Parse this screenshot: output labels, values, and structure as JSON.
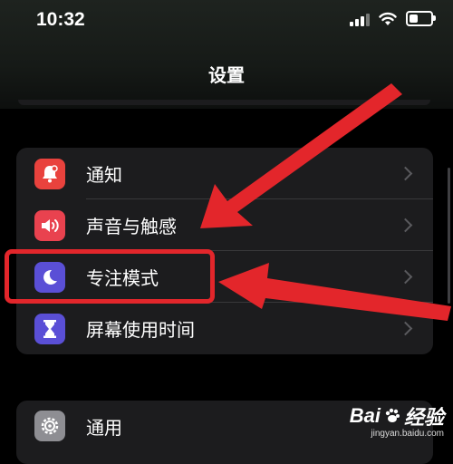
{
  "status": {
    "time": "10:32"
  },
  "nav": {
    "title": "设置"
  },
  "group1": [
    {
      "label": "通知",
      "icon": "bell-icon",
      "color": "#e9423d"
    },
    {
      "label": "声音与触感",
      "icon": "speaker-icon",
      "color": "#e9424f"
    },
    {
      "label": "专注模式",
      "icon": "moon-icon",
      "color": "#5a4fd6"
    },
    {
      "label": "屏幕使用时间",
      "icon": "hourglass-icon",
      "color": "#5a4fd6"
    }
  ],
  "group2": [
    {
      "label": "通用",
      "icon": "gear-icon",
      "color": "#8e8e93"
    }
  ],
  "watermark": {
    "brand": "Bai",
    "brand2": "经验",
    "url": "jingyan.baidu.com"
  },
  "colors": {
    "highlight": "#e2262b",
    "arrow": "#e3262b"
  }
}
